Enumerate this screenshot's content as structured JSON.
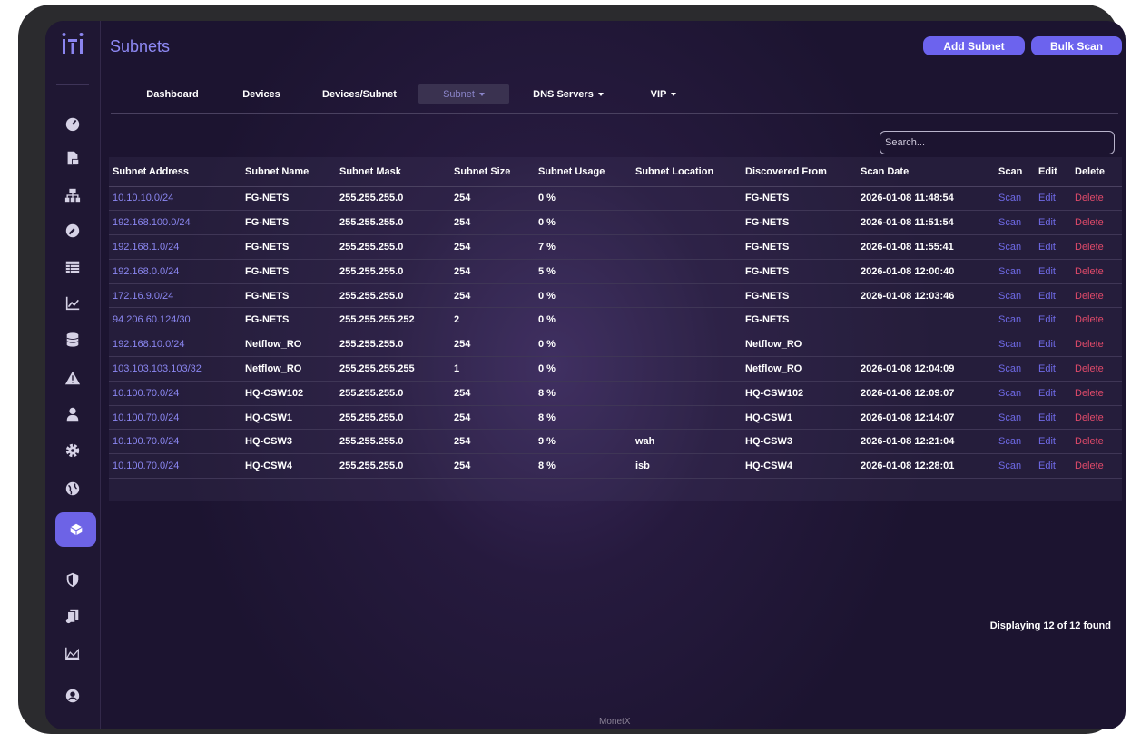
{
  "app": {
    "title": "Subnets",
    "footer": "MonetX"
  },
  "header": {
    "add_label": "Add Subnet",
    "bulk_label": "Bulk Scan"
  },
  "tabs": [
    {
      "label": "Dashboard"
    },
    {
      "label": "Devices"
    },
    {
      "label": "Devices/Subnet"
    },
    {
      "label": "Subnet",
      "active": true
    },
    {
      "label": "DNS Servers"
    },
    {
      "label": "VIP"
    }
  ],
  "search": {
    "placeholder": "Search..."
  },
  "sidebar": {
    "icons": [
      "dashboard-icon",
      "report-icon",
      "topology-icon",
      "tools-icon",
      "table-icon",
      "chart-icon",
      "database-icon",
      "alert-icon",
      "user-icon",
      "settings-icon",
      "globe-icon",
      "cube-icon",
      "shield-icon",
      "documents-icon",
      "area-chart-icon",
      "account-icon"
    ],
    "active": "cube-icon"
  },
  "table": {
    "columns": [
      "Subnet Address",
      "Subnet Name",
      "Subnet Mask",
      "Subnet Size",
      "Subnet Usage",
      "Subnet Location",
      "Discovered From",
      "Scan Date",
      "Scan",
      "Edit",
      "Delete"
    ],
    "rows": [
      [
        "10.10.10.0/24",
        "FG-NETS",
        "255.255.255.0",
        "254",
        "0 %",
        "",
        "FG-NETS",
        "2026-01-08 11:48:54",
        "Scan",
        "Edit",
        "Delete"
      ],
      [
        "192.168.100.0/24",
        "FG-NETS",
        "255.255.255.0",
        "254",
        "0 %",
        "",
        "FG-NETS",
        "2026-01-08 11:51:54",
        "Scan",
        "Edit",
        "Delete"
      ],
      [
        "192.168.1.0/24",
        "FG-NETS",
        "255.255.255.0",
        "254",
        "7 %",
        "",
        "FG-NETS",
        "2026-01-08 11:55:41",
        "Scan",
        "Edit",
        "Delete"
      ],
      [
        "192.168.0.0/24",
        "FG-NETS",
        "255.255.255.0",
        "254",
        "5 %",
        "",
        "FG-NETS",
        "2026-01-08 12:00:40",
        "Scan",
        "Edit",
        "Delete"
      ],
      [
        "172.16.9.0/24",
        "FG-NETS",
        "255.255.255.0",
        "254",
        "0 %",
        "",
        "FG-NETS",
        "2026-01-08 12:03:46",
        "Scan",
        "Edit",
        "Delete"
      ],
      [
        "94.206.60.124/30",
        "FG-NETS",
        "255.255.255.252",
        "2",
        "0 %",
        "",
        "FG-NETS",
        "",
        "Scan",
        "Edit",
        "Delete"
      ],
      [
        "192.168.10.0/24",
        "Netflow_RO",
        "255.255.255.0",
        "254",
        "0 %",
        "",
        "Netflow_RO",
        "",
        "Scan",
        "Edit",
        "Delete"
      ],
      [
        "103.103.103.103/32",
        "Netflow_RO",
        "255.255.255.255",
        "1",
        "0 %",
        "",
        "Netflow_RO",
        "2026-01-08 12:04:09",
        "Scan",
        "Edit",
        "Delete"
      ],
      [
        "10.100.70.0/24",
        "HQ-CSW102",
        "255.255.255.0",
        "254",
        "8 %",
        "",
        "HQ-CSW102",
        "2026-01-08 12:09:07",
        "Scan",
        "Edit",
        "Delete"
      ],
      [
        "10.100.70.0/24",
        "HQ-CSW1",
        "255.255.255.0",
        "254",
        "8 %",
        "",
        "HQ-CSW1",
        "2026-01-08 12:14:07",
        "Scan",
        "Edit",
        "Delete"
      ],
      [
        "10.100.70.0/24",
        "HQ-CSW3",
        "255.255.255.0",
        "254",
        "9 %",
        "wah",
        "HQ-CSW3",
        "2026-01-08 12:21:04",
        "Scan",
        "Edit",
        "Delete"
      ],
      [
        "10.100.70.0/24",
        "HQ-CSW4",
        "255.255.255.0",
        "254",
        "8 %",
        "isb",
        "HQ-CSW4",
        "2026-01-08 12:28:01",
        "Scan",
        "Edit",
        "Delete"
      ]
    ],
    "footer": "Displaying 12 of 12 found"
  },
  "colors": {
    "accent": "#6c63ee",
    "link": "#8a86f0",
    "delete": "#e04a6a",
    "background": "#1c1430"
  }
}
